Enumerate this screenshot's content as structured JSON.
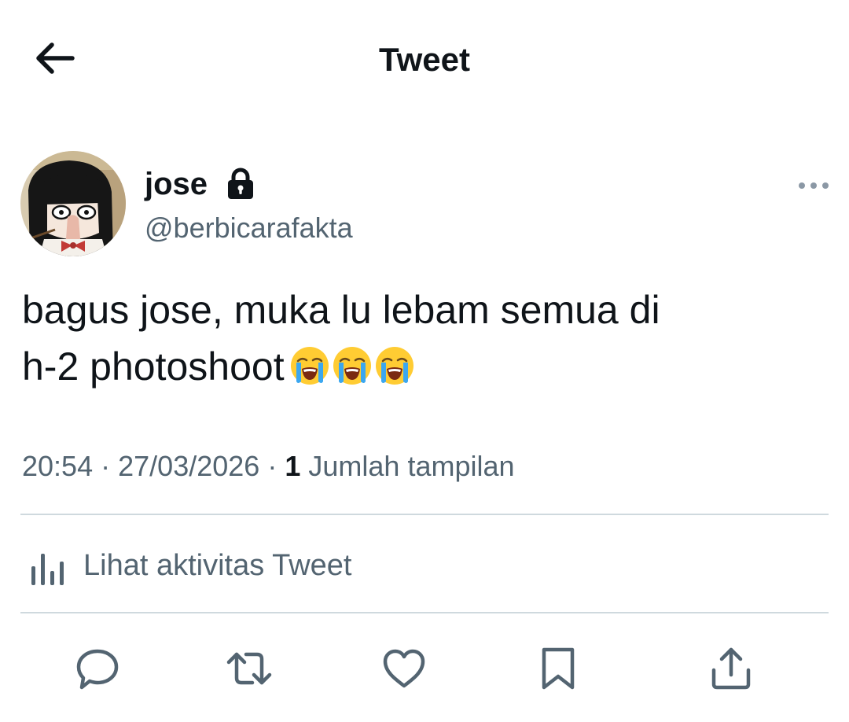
{
  "header": {
    "title": "Tweet",
    "back_icon": "arrow-left-icon"
  },
  "tweet": {
    "author": {
      "display_name": "jose",
      "handle": "@berbicarafakta",
      "protected_icon": "lock-icon"
    },
    "text_line1": "bagus jose, muka lu lebam semua di",
    "text_line2": "h-2 photoshoot",
    "emojis": [
      "loudly-crying-face",
      "loudly-crying-face",
      "loudly-crying-face"
    ],
    "time": "20:54",
    "separator": "·",
    "date": "27/03/2026",
    "views_count": "1",
    "views_label": "Jumlah tampilan"
  },
  "activity": {
    "label": "Lihat aktivitas Tweet",
    "icon": "bar-chart-icon"
  },
  "actions": [
    {
      "name": "reply",
      "icon": "reply-icon"
    },
    {
      "name": "retweet",
      "icon": "retweet-icon"
    },
    {
      "name": "like",
      "icon": "heart-icon"
    },
    {
      "name": "bookmark",
      "icon": "bookmark-icon"
    },
    {
      "name": "share",
      "icon": "share-icon"
    }
  ],
  "colors": {
    "text_primary": "#0f1419",
    "text_secondary": "#536471",
    "divider": "#cfd9de",
    "icon": "#536471"
  }
}
